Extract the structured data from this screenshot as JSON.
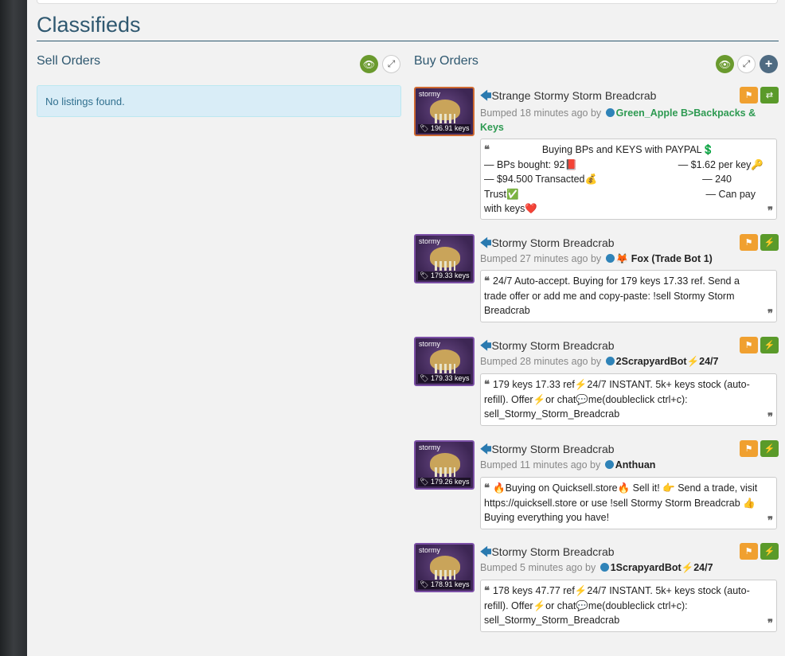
{
  "page": {
    "title": "Classifieds"
  },
  "sell": {
    "heading": "Sell Orders",
    "empty_text": "No listings found.",
    "controls": [
      "eye-icon",
      "expand-icon"
    ]
  },
  "buy": {
    "heading": "Buy Orders",
    "controls": [
      "eye-icon",
      "expand-icon",
      "plus-icon"
    ],
    "listings": [
      {
        "img_label": "stormy",
        "price": "196.91 keys",
        "name": "Strange Stormy Storm Breadcrab",
        "bumped": "Bumped 18 minutes ago by",
        "user": "Green_Apple B>Backpacks & Keys",
        "user_color": "#2e9a52",
        "action_icon": "exchange-icon",
        "message_title": "Buying BPs and KEYS with PAYPAL💲",
        "message_lines": [
          [
            "— BPs bought: 92📕",
            "— $1.62 per key🔑"
          ],
          [
            "— $94.500 Transacted💰",
            "— 240"
          ],
          [
            "Trust✅",
            "— Can pay"
          ],
          [
            "with keys❤️",
            ""
          ]
        ]
      },
      {
        "img_label": "stormy",
        "price": "179.33 keys",
        "name": "Stormy Storm Breadcrab",
        "bumped": "Bumped 27 minutes ago by",
        "user": "🦊 Fox (Trade Bot 1)",
        "action_icon": "lightning-icon",
        "message": "24/7 Auto-accept. Buying for 179 keys 17.33 ref. Send a trade offer or add me and copy-paste: !sell Stormy Storm Breadcrab"
      },
      {
        "img_label": "stormy",
        "price": "179.33 keys",
        "name": "Stormy Storm Breadcrab",
        "bumped": "Bumped 28 minutes ago by",
        "user": "2ScrapyardBot⚡24/7",
        "action_icon": "lightning-icon",
        "message": "179 keys 17.33 ref⚡24/7 INSTANT. 5k+ keys stock (auto-refill). Offer⚡or chat💬me(doubleclick ctrl+c): sell_Stormy_Storm_Breadcrab"
      },
      {
        "img_label": "stormy",
        "price": "179.26 keys",
        "name": "Stormy Storm Breadcrab",
        "bumped": "Bumped 11 minutes ago by",
        "user": "Anthuan",
        "action_icon": "lightning-icon",
        "message": "🔥Buying on Quicksell.store🔥 Sell it! 👉 Send a trade, visit https://quicksell.store or use !sell Stormy Storm Breadcrab 👍 Buying everything you have!"
      },
      {
        "img_label": "stormy",
        "price": "178.91 keys",
        "name": "Stormy Storm Breadcrab",
        "bumped": "Bumped 5 minutes ago by",
        "user": "1ScrapyardBot⚡24/7",
        "action_icon": "lightning-icon",
        "message": "178 keys 47.77 ref⚡24/7 INSTANT. 5k+ keys stock (auto-refill). Offer⚡or chat💬me(doubleclick ctrl+c): sell_Stormy_Storm_Breadcrab"
      }
    ]
  },
  "colors": {
    "heading": "#2f5870",
    "green": "#6a9a2e",
    "flag": "#f0a030",
    "info_bg": "#d9edf7"
  }
}
